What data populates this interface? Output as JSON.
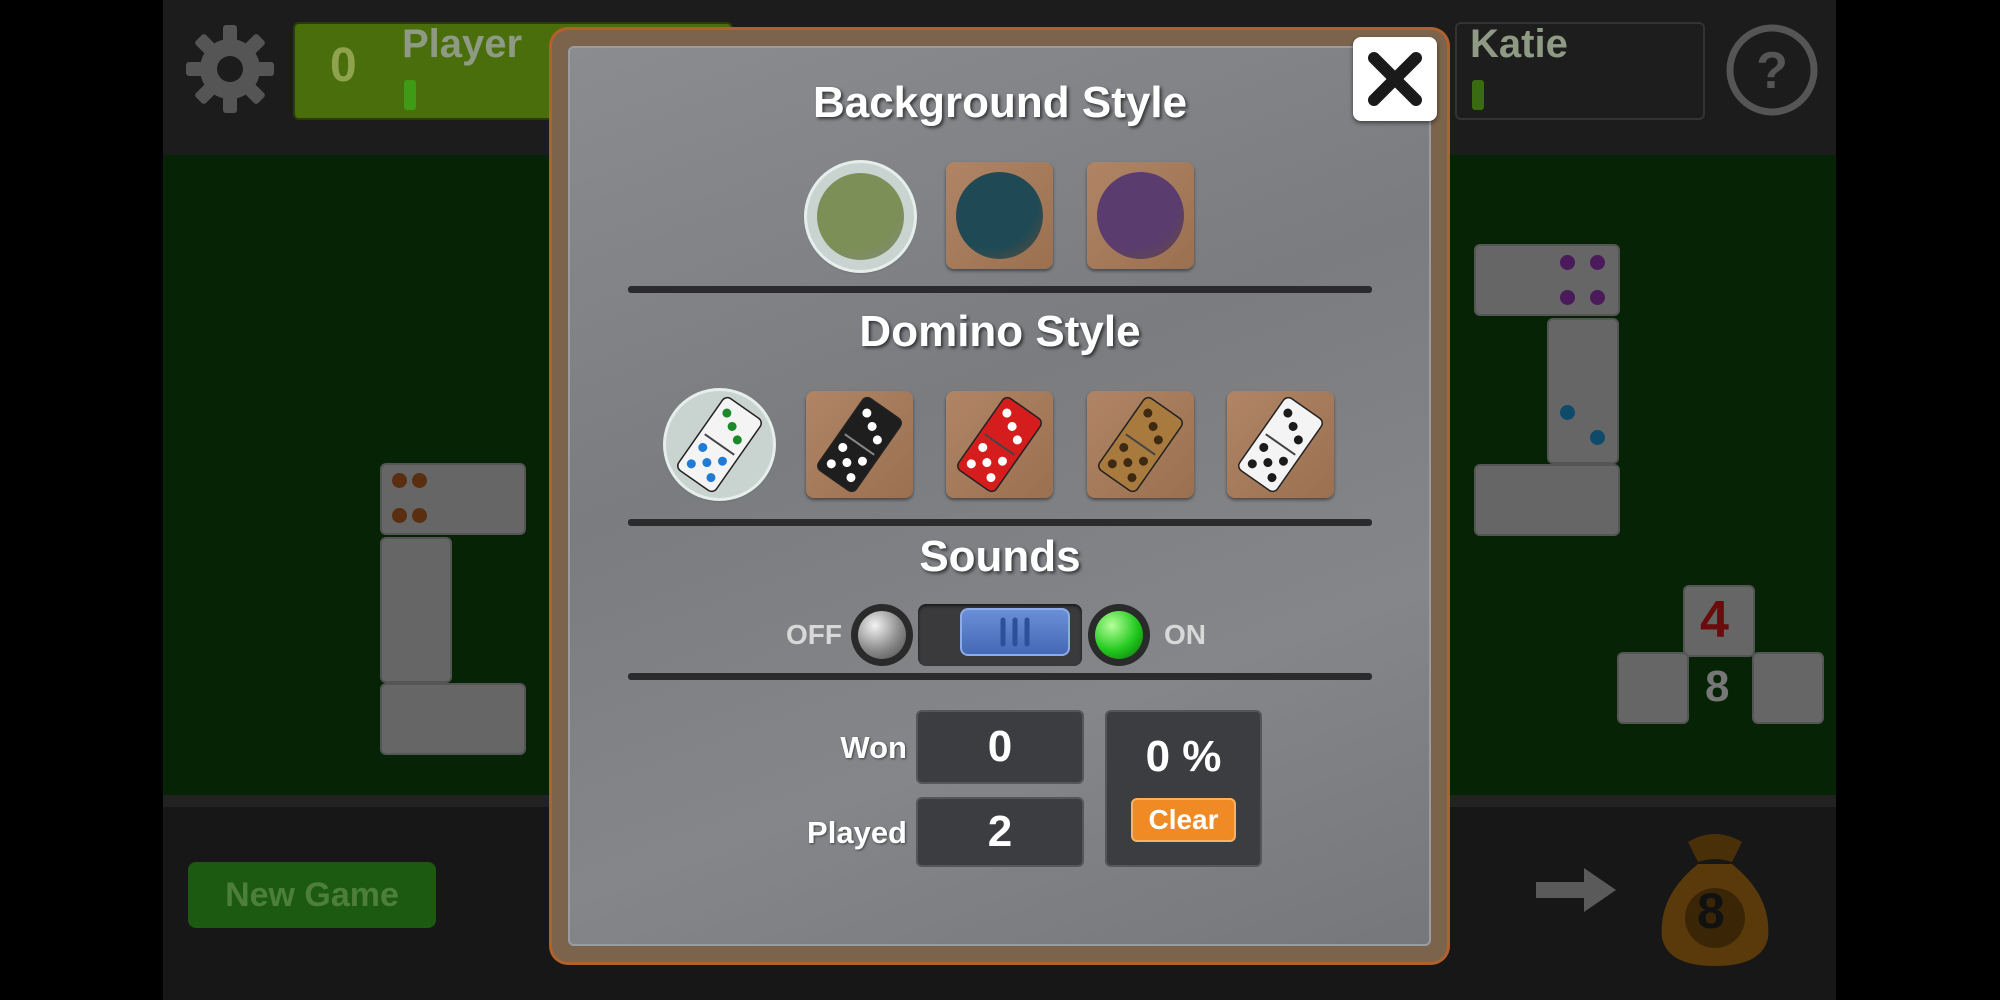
{
  "background_game": {
    "player": {
      "score": "0",
      "name": "Player"
    },
    "opponent": {
      "name": "Katie"
    },
    "new_game_label": "New Game",
    "boneyard_count": "8",
    "side_panel": {
      "top_number": "4",
      "center_number": "8"
    }
  },
  "settings_dialog": {
    "background_style": {
      "title": "Background Style",
      "options": [
        {
          "name": "green",
          "color": "#7c8f56",
          "selected": true
        },
        {
          "name": "teal",
          "color": "#1f4a55",
          "selected": false
        },
        {
          "name": "purple",
          "color": "#5a3c6e",
          "selected": false
        }
      ]
    },
    "domino_style": {
      "title": "Domino Style",
      "options": [
        {
          "name": "white-colored-pips",
          "face": "#f4f4f4",
          "pip": "#1f7bd6",
          "selected": true
        },
        {
          "name": "black",
          "face": "#1e1e1e",
          "pip": "#ffffff",
          "selected": false
        },
        {
          "name": "red",
          "face": "#d61d1d",
          "pip": "#ffffff",
          "selected": false
        },
        {
          "name": "wood",
          "face": "#a87a3d",
          "pip": "#3e2a12",
          "selected": false
        },
        {
          "name": "white-black-pips",
          "face": "#f4f4f4",
          "pip": "#1b1b1b",
          "selected": false
        }
      ]
    },
    "sounds": {
      "title": "Sounds",
      "off_label": "OFF",
      "on_label": "ON",
      "enabled": true
    },
    "stats": {
      "won_label": "Won",
      "won_value": "0",
      "played_label": "Played",
      "played_value": "2",
      "percent": "0 %",
      "clear_label": "Clear"
    }
  },
  "colors": {
    "accent_orange": "#f08a24",
    "toggle_blue": "#4568b6",
    "on_green": "#22c91e"
  }
}
